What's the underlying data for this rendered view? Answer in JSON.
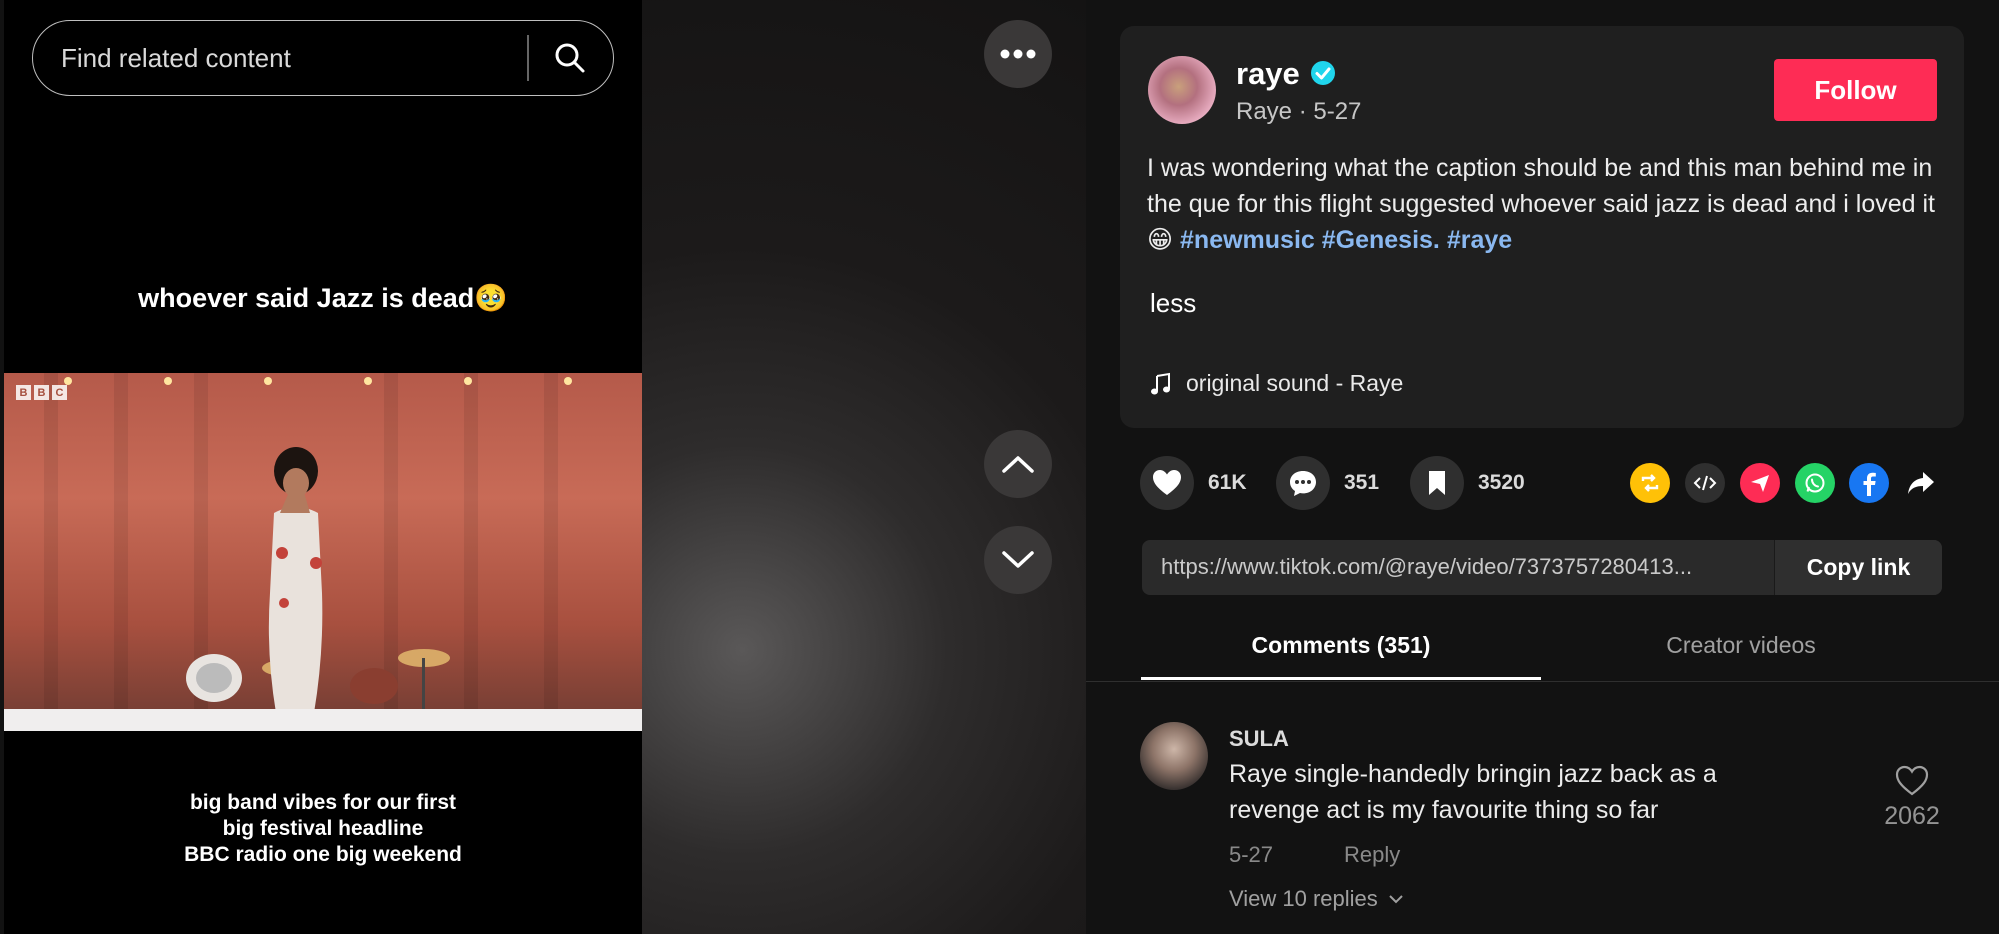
{
  "search": {
    "placeholder": "Find related content"
  },
  "video": {
    "title": "whoever said Jazz is dead🥹",
    "caption_lines": [
      "big band vibes for our first",
      "big festival headline",
      "BBC radio one big weekend"
    ],
    "bbc_letters": [
      "B",
      "B",
      "C"
    ]
  },
  "nav": {
    "more_icon": "more-horizontal-icon",
    "up_icon": "chevron-up-icon",
    "down_icon": "chevron-down-icon"
  },
  "post": {
    "author": "raye",
    "meta": "Raye · 5-27",
    "follow_label": "Follow",
    "description": "I was wondering what the caption should be and this man behind me in the que for this flight suggested whoever said jazz is dead and i loved it 😁",
    "hashtags": [
      "#newmusic",
      "#Genesis.",
      "#raye"
    ],
    "less_label": "less",
    "music": "original sound - Raye"
  },
  "actions": {
    "likes": "61K",
    "comments": "351",
    "saves": "3520"
  },
  "share_icons": [
    "repost-icon",
    "embed-code-icon",
    "send-to-friends-icon",
    "whatsapp-icon",
    "facebook-icon",
    "share-arrow-icon"
  ],
  "link": {
    "url": "https://www.tiktok.com/@raye/video/7373757280413...",
    "copy_label": "Copy link"
  },
  "tabs": [
    {
      "label": "Comments (351)",
      "active": true
    },
    {
      "label": "Creator videos",
      "active": false
    }
  ],
  "comment": {
    "author": "SULA",
    "text": "Raye single-handedly bringin jazz back as a revenge act is my favourite thing so far",
    "date": "5-27",
    "reply_label": "Reply",
    "view_replies": "View 10 replies",
    "likes": "2062"
  },
  "colors": {
    "follow": "#fe2c55",
    "verified": "#20d5ec",
    "hashtag": "#8ab8f0",
    "repost": "#ffc107",
    "send": "#fe2c55",
    "whatsapp": "#25d366",
    "facebook": "#1877f2"
  }
}
